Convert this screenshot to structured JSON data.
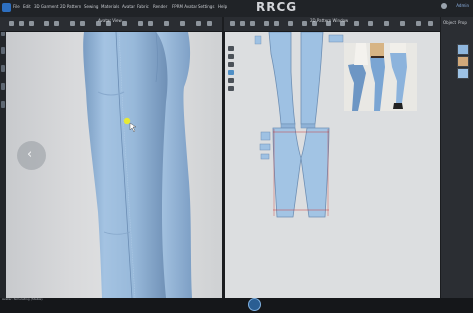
{
  "app": {
    "watermark": "RRCG",
    "user": "Admin"
  },
  "menu": [
    "File",
    "Edit",
    "3D Garment",
    "2D Pattern",
    "Sewing",
    "Materials",
    "Avatar",
    "Fabric",
    "Render",
    "FPRM Avatar",
    "Settings",
    "Help"
  ],
  "panels": {
    "view3d_title": "Avatar View",
    "view2d_title": "2D Pattern Window"
  },
  "right_panel": {
    "tab1": "Object",
    "tab2": "Prop",
    "swatches": [
      "#8fb7de",
      "#d2a97a",
      "#9ec3e6"
    ]
  },
  "status": {
    "text": "Avatar: Simulating (Stable)"
  },
  "colors": {
    "denim": "#9ebfe0",
    "denim_dark": "#7ea3c9",
    "accent": "#2d6fc0"
  },
  "icons": {
    "back": "chevron-left-icon"
  }
}
